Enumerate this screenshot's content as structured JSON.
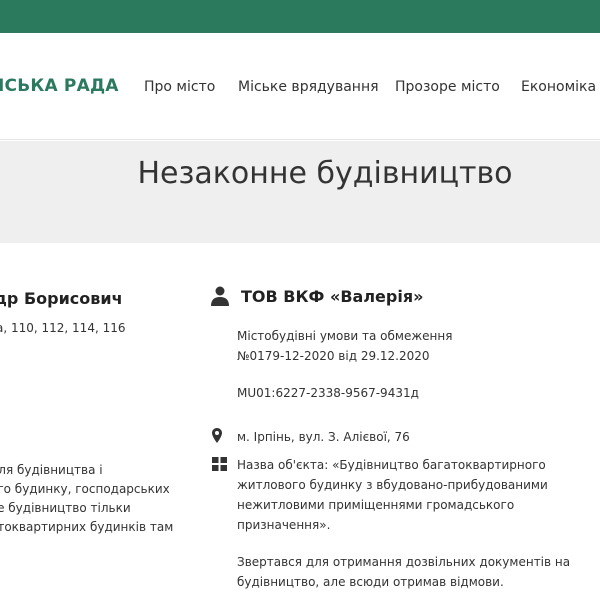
{
  "header": {
    "logo": "ІСЬКА РАДА",
    "nav": [
      "Про місто",
      "Міське врядування",
      "Прозоре місто",
      "Економіка"
    ]
  },
  "hero": {
    "title": "Незаконне будівництво"
  },
  "left": {
    "name": "др Борисович",
    "address": "а, 110, 112, 114, 116",
    "para": [
      "для будівництва і",
      "ого будинку, господарських",
      "ве будівництво тільки",
      "атоквартирних будинків там"
    ]
  },
  "right": {
    "title": "ТОВ ВКФ «Валерія»",
    "conditions_l1": "Містобудівні умови та обмеження",
    "conditions_l2": "№0179-12-2020 від 29.12.2020",
    "code": "MU01:6227-2338-9567-9431д",
    "location": "м. Ірпінь, вул. З. Алієвої, 76",
    "object_l1": "Назва об'єкта: «Будівництво багатоквартирного",
    "object_l2": "житлового будинку з вбудовано-прибудованими",
    "object_l3": "нежитловими приміщеннями громадського",
    "object_l4": "призначення».",
    "note_l1": "Звертався для отримання дозвільних документів на",
    "note_l2": "будівництво, але всюди отримав відмови."
  },
  "colors": {
    "brand": "#2b7a5e",
    "hero_bg": "#efefef"
  },
  "icons": [
    "user-icon",
    "map-pin-icon",
    "grid-icon"
  ]
}
